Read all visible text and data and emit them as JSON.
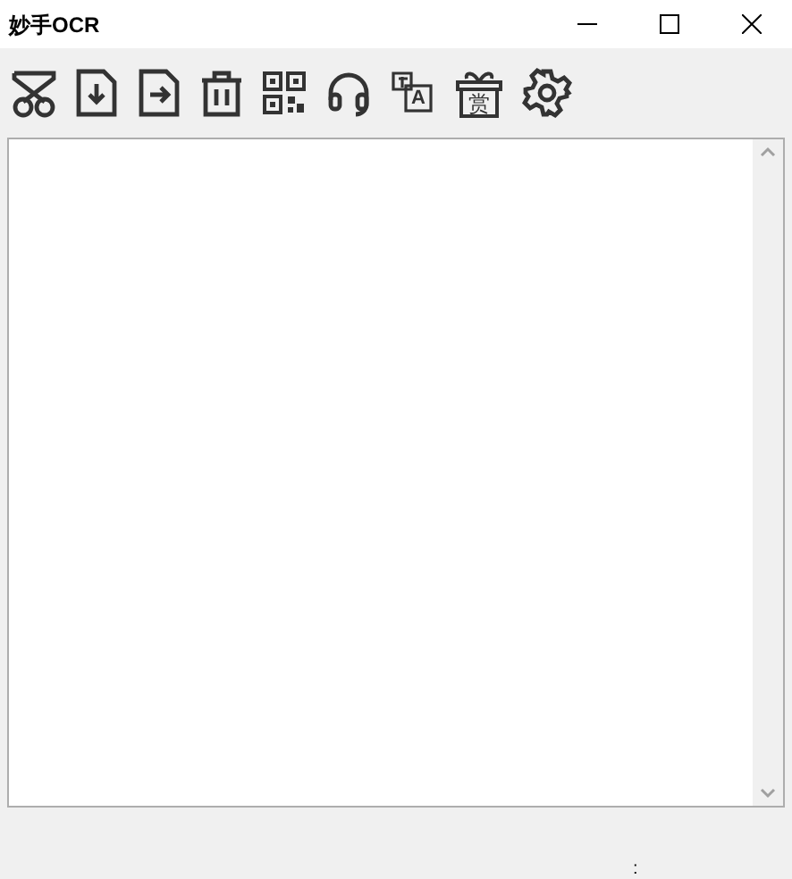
{
  "window": {
    "title": "妙手OCR"
  },
  "toolbar": [
    {
      "kind": "scissors"
    },
    {
      "kind": "download"
    },
    {
      "kind": "export"
    },
    {
      "kind": "trash"
    },
    {
      "kind": "qrcode"
    },
    {
      "kind": "headset"
    },
    {
      "kind": "translate",
      "glyph": "A"
    },
    {
      "kind": "gift",
      "glyph": "赏"
    },
    {
      "kind": "settings"
    }
  ],
  "status_bar": {
    "text": ":"
  }
}
